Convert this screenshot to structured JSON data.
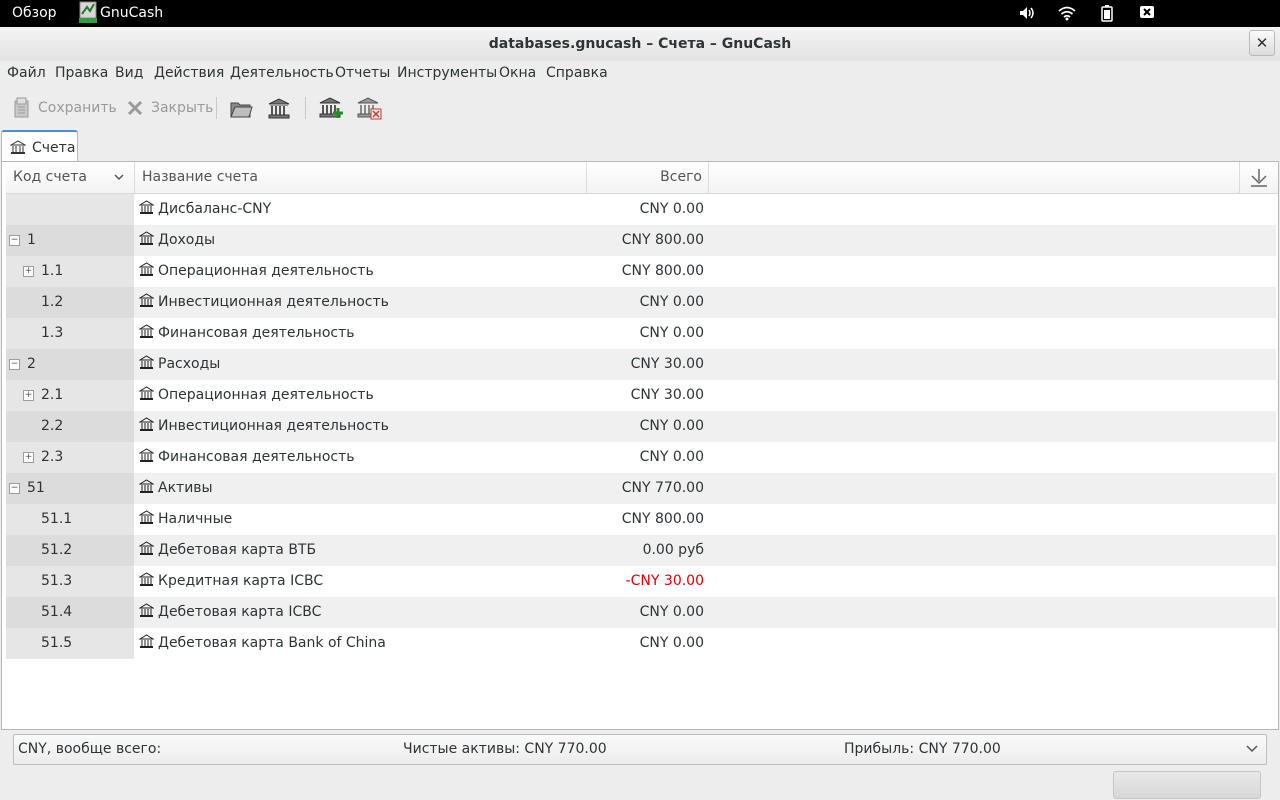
{
  "topbar": {
    "overview": "Обзор",
    "app_name": "GnuCash",
    "tray_icons": [
      "volume-icon",
      "wifi-icon",
      "battery-icon",
      "power-icon"
    ]
  },
  "window": {
    "title": "databases.gnucash – Счета – GnuCash",
    "close": "✕"
  },
  "menu": [
    "Файл",
    "Правка",
    "Вид",
    "Действия",
    "Деятельность",
    "Отчеты",
    "Инструменты",
    "Окна",
    "Справка"
  ],
  "toolbar": {
    "save_label": "Сохранить",
    "close_label": "Закрыть"
  },
  "tab": {
    "label": "Счета"
  },
  "columns": {
    "code": "Код счета",
    "name": "Название счета",
    "total": "Всего"
  },
  "accounts": [
    {
      "code": "",
      "name": "Дисбаланс-CNY",
      "total": "CNY 0.00",
      "expander": "",
      "depth": 0
    },
    {
      "code": "1",
      "name": "Доходы",
      "total": "CNY 800.00",
      "expander": "−",
      "depth": 0
    },
    {
      "code": "1.1",
      "name": "Операционная деятельность",
      "total": "CNY 800.00",
      "expander": "+",
      "depth": 1
    },
    {
      "code": "1.2",
      "name": "Инвестиционная деятельность",
      "total": "CNY 0.00",
      "expander": "",
      "depth": 1
    },
    {
      "code": "1.3",
      "name": "Финансовая деятельность",
      "total": "CNY 0.00",
      "expander": "",
      "depth": 1
    },
    {
      "code": "2",
      "name": "Расходы",
      "total": "CNY 30.00",
      "expander": "−",
      "depth": 0
    },
    {
      "code": "2.1",
      "name": "Операционная деятельность",
      "total": "CNY 30.00",
      "expander": "+",
      "depth": 1
    },
    {
      "code": "2.2",
      "name": "Инвестиционная деятельность",
      "total": "CNY 0.00",
      "expander": "",
      "depth": 1
    },
    {
      "code": "2.3",
      "name": "Финансовая деятельность",
      "total": "CNY 0.00",
      "expander": "+",
      "depth": 1
    },
    {
      "code": "51",
      "name": "Активы",
      "total": "CNY 770.00",
      "expander": "−",
      "depth": 0
    },
    {
      "code": "51.1",
      "name": "Наличные",
      "total": "CNY 800.00",
      "expander": "",
      "depth": 1
    },
    {
      "code": "51.2",
      "name": "Дебетовая карта ВТБ",
      "total": "0.00 руб",
      "expander": "",
      "depth": 1
    },
    {
      "code": "51.3",
      "name": "Кредитная карта ICBC",
      "total": "-CNY 30.00",
      "expander": "",
      "depth": 1,
      "negative": true
    },
    {
      "code": "51.4",
      "name": "Дебетовая карта ICBC",
      "total": "CNY 0.00",
      "expander": "",
      "depth": 1
    },
    {
      "code": "51.5",
      "name": "Дебетовая карта Bank of China",
      "total": "CNY 0.00",
      "expander": "",
      "depth": 1
    }
  ],
  "summary": {
    "currency_label": "CNY, вообще всего:",
    "net_assets": "Чистые активы: CNY 770.00",
    "profit": "Прибыль: CNY 770.00"
  },
  "colors": {
    "negative": "#e00000",
    "tab_accent": "#4a90d9"
  }
}
